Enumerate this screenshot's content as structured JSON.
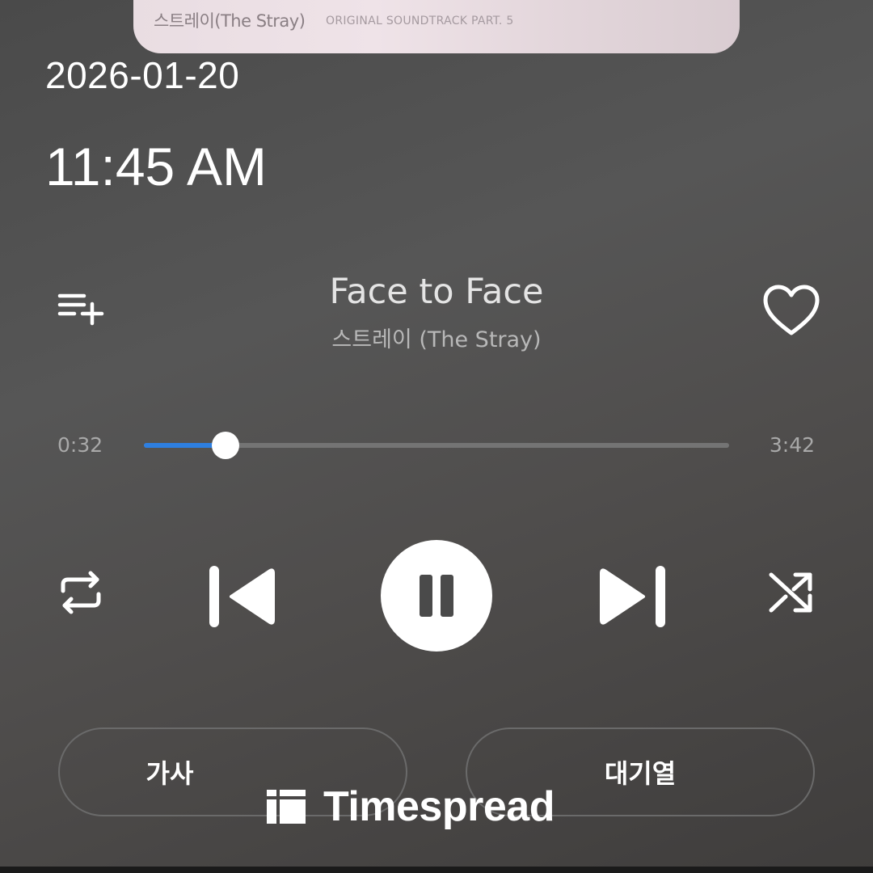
{
  "album": {
    "title_text": "스트레이(The Stray)",
    "subtitle_text": "ORIGINAL SOUNDTRACK PART. 5"
  },
  "status": {
    "date": "2026-01-20",
    "time": "11:45 AM"
  },
  "track": {
    "title": "Face to Face",
    "artist": "스트레이 (The Stray)",
    "elapsed": "0:32",
    "duration": "3:42",
    "progress_fraction": 0.14
  },
  "controls": {
    "queue_add_icon": "playlist-add-icon",
    "like_icon": "heart-outline-icon",
    "repeat_icon": "repeat-icon",
    "previous_icon": "skip-previous-icon",
    "pause_icon": "pause-icon",
    "next_icon": "skip-next-icon",
    "shuffle_icon": "shuffle-icon"
  },
  "buttons": {
    "lyrics_label": "가사",
    "queue_label": "대기열"
  },
  "watermark": {
    "text": "Timespread"
  },
  "colors": {
    "accent": "#2e7fe0",
    "background": "#4f4f4f"
  }
}
